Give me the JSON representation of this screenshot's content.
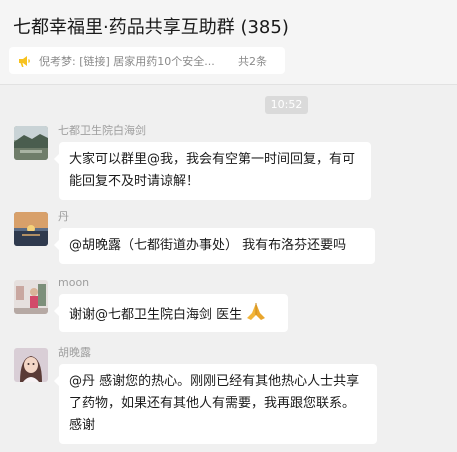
{
  "header": {
    "title": "七都幸福里·药品共享互助群 (385)",
    "pinned": {
      "icon": "announcement-icon",
      "text": "倪考梦: [链接] 居家用药10个安全...",
      "count": "共2条"
    }
  },
  "chat": {
    "time": "10:52",
    "messages": [
      {
        "sender": "七都卫生院白海剑",
        "avatar": "landscape-avatar",
        "text": "大家可以群里@我，我会有空第一时间回复，有可能回复不及时请谅解！"
      },
      {
        "sender": "丹",
        "avatar": "sunset-avatar",
        "text": "@胡晚露（七都街道办事处） 我有布洛芬还要吗"
      },
      {
        "sender": "moon",
        "avatar": "photo-avatar",
        "text": "谢谢@七都卫生院白海剑 医生",
        "emoji": "praying-hands-icon"
      },
      {
        "sender": "胡晚露",
        "avatar": "portrait-avatar",
        "text": "@丹 感谢您的热心。刚刚已经有其他热心人士共享了药物，如果还有其他人有需要，我再跟您联系。感谢"
      }
    ]
  },
  "colors": {
    "background": "#f0f0f0",
    "bubble": "#ffffff",
    "sender": "#9e9e9e",
    "announcement": "#f7c21e"
  }
}
